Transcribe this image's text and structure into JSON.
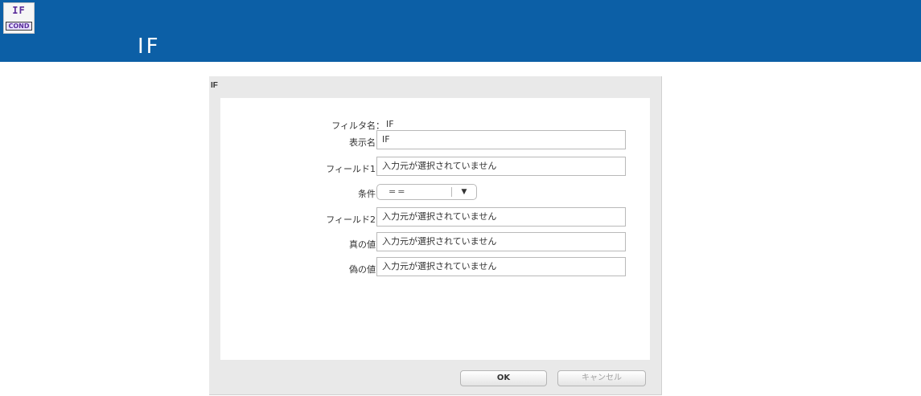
{
  "header": {
    "icon": {
      "name": "if-cond-icon",
      "top_text": "IF",
      "bottom_text": "COND"
    },
    "title": "IF",
    "background_color": "#0c5fa6"
  },
  "dialog": {
    "title": "IF",
    "rows": [
      {
        "label": "フィルタ名：",
        "value": "IF"
      },
      {
        "label": "表示名：",
        "value": "IF"
      },
      {
        "label": "フィールド1：",
        "value": "入力元が選択されていません"
      },
      {
        "label": "条件：",
        "value": "=="
      },
      {
        "label": "フィールド2：",
        "value": "入力元が選択されていません"
      },
      {
        "label": "真の値：",
        "value": "入力元が選択されていません"
      },
      {
        "label": "偽の値：",
        "value": "入力元が選択されていません"
      }
    ],
    "buttons": {
      "ok": "OK",
      "cancel": "キャンセル"
    }
  }
}
